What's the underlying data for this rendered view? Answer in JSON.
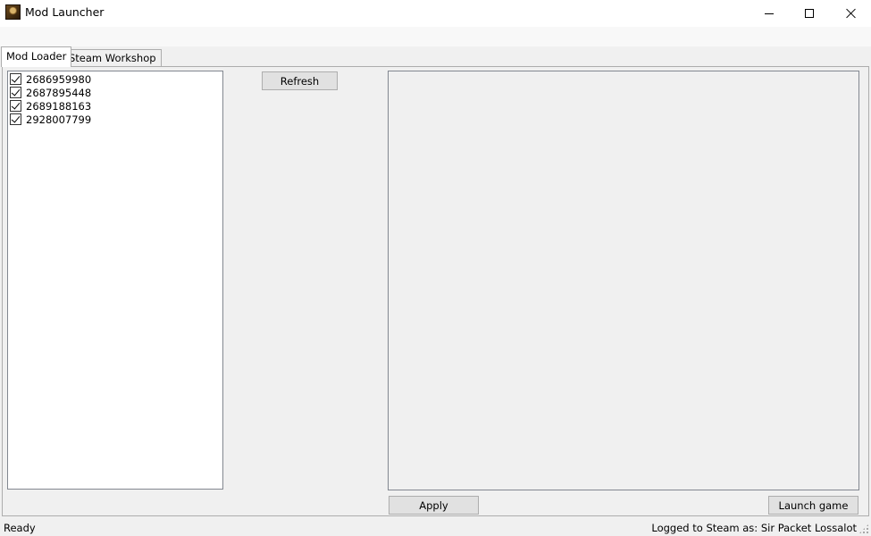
{
  "window": {
    "title": "Mod Launcher"
  },
  "tabs": [
    {
      "label": "Mod Loader",
      "active": true
    },
    {
      "label": "Steam Workshop",
      "active": false
    }
  ],
  "mod_list": {
    "items": [
      {
        "label": "2686959980",
        "checked": true
      },
      {
        "label": "2687895448",
        "checked": true
      },
      {
        "label": "2689188163",
        "checked": true
      },
      {
        "label": "2928007799",
        "checked": true
      }
    ]
  },
  "buttons": {
    "refresh": "Refresh",
    "apply": "Apply",
    "launch": "Launch game"
  },
  "status": {
    "left": "Ready",
    "right": "Logged to Steam as: Sir Packet Lossalot"
  }
}
